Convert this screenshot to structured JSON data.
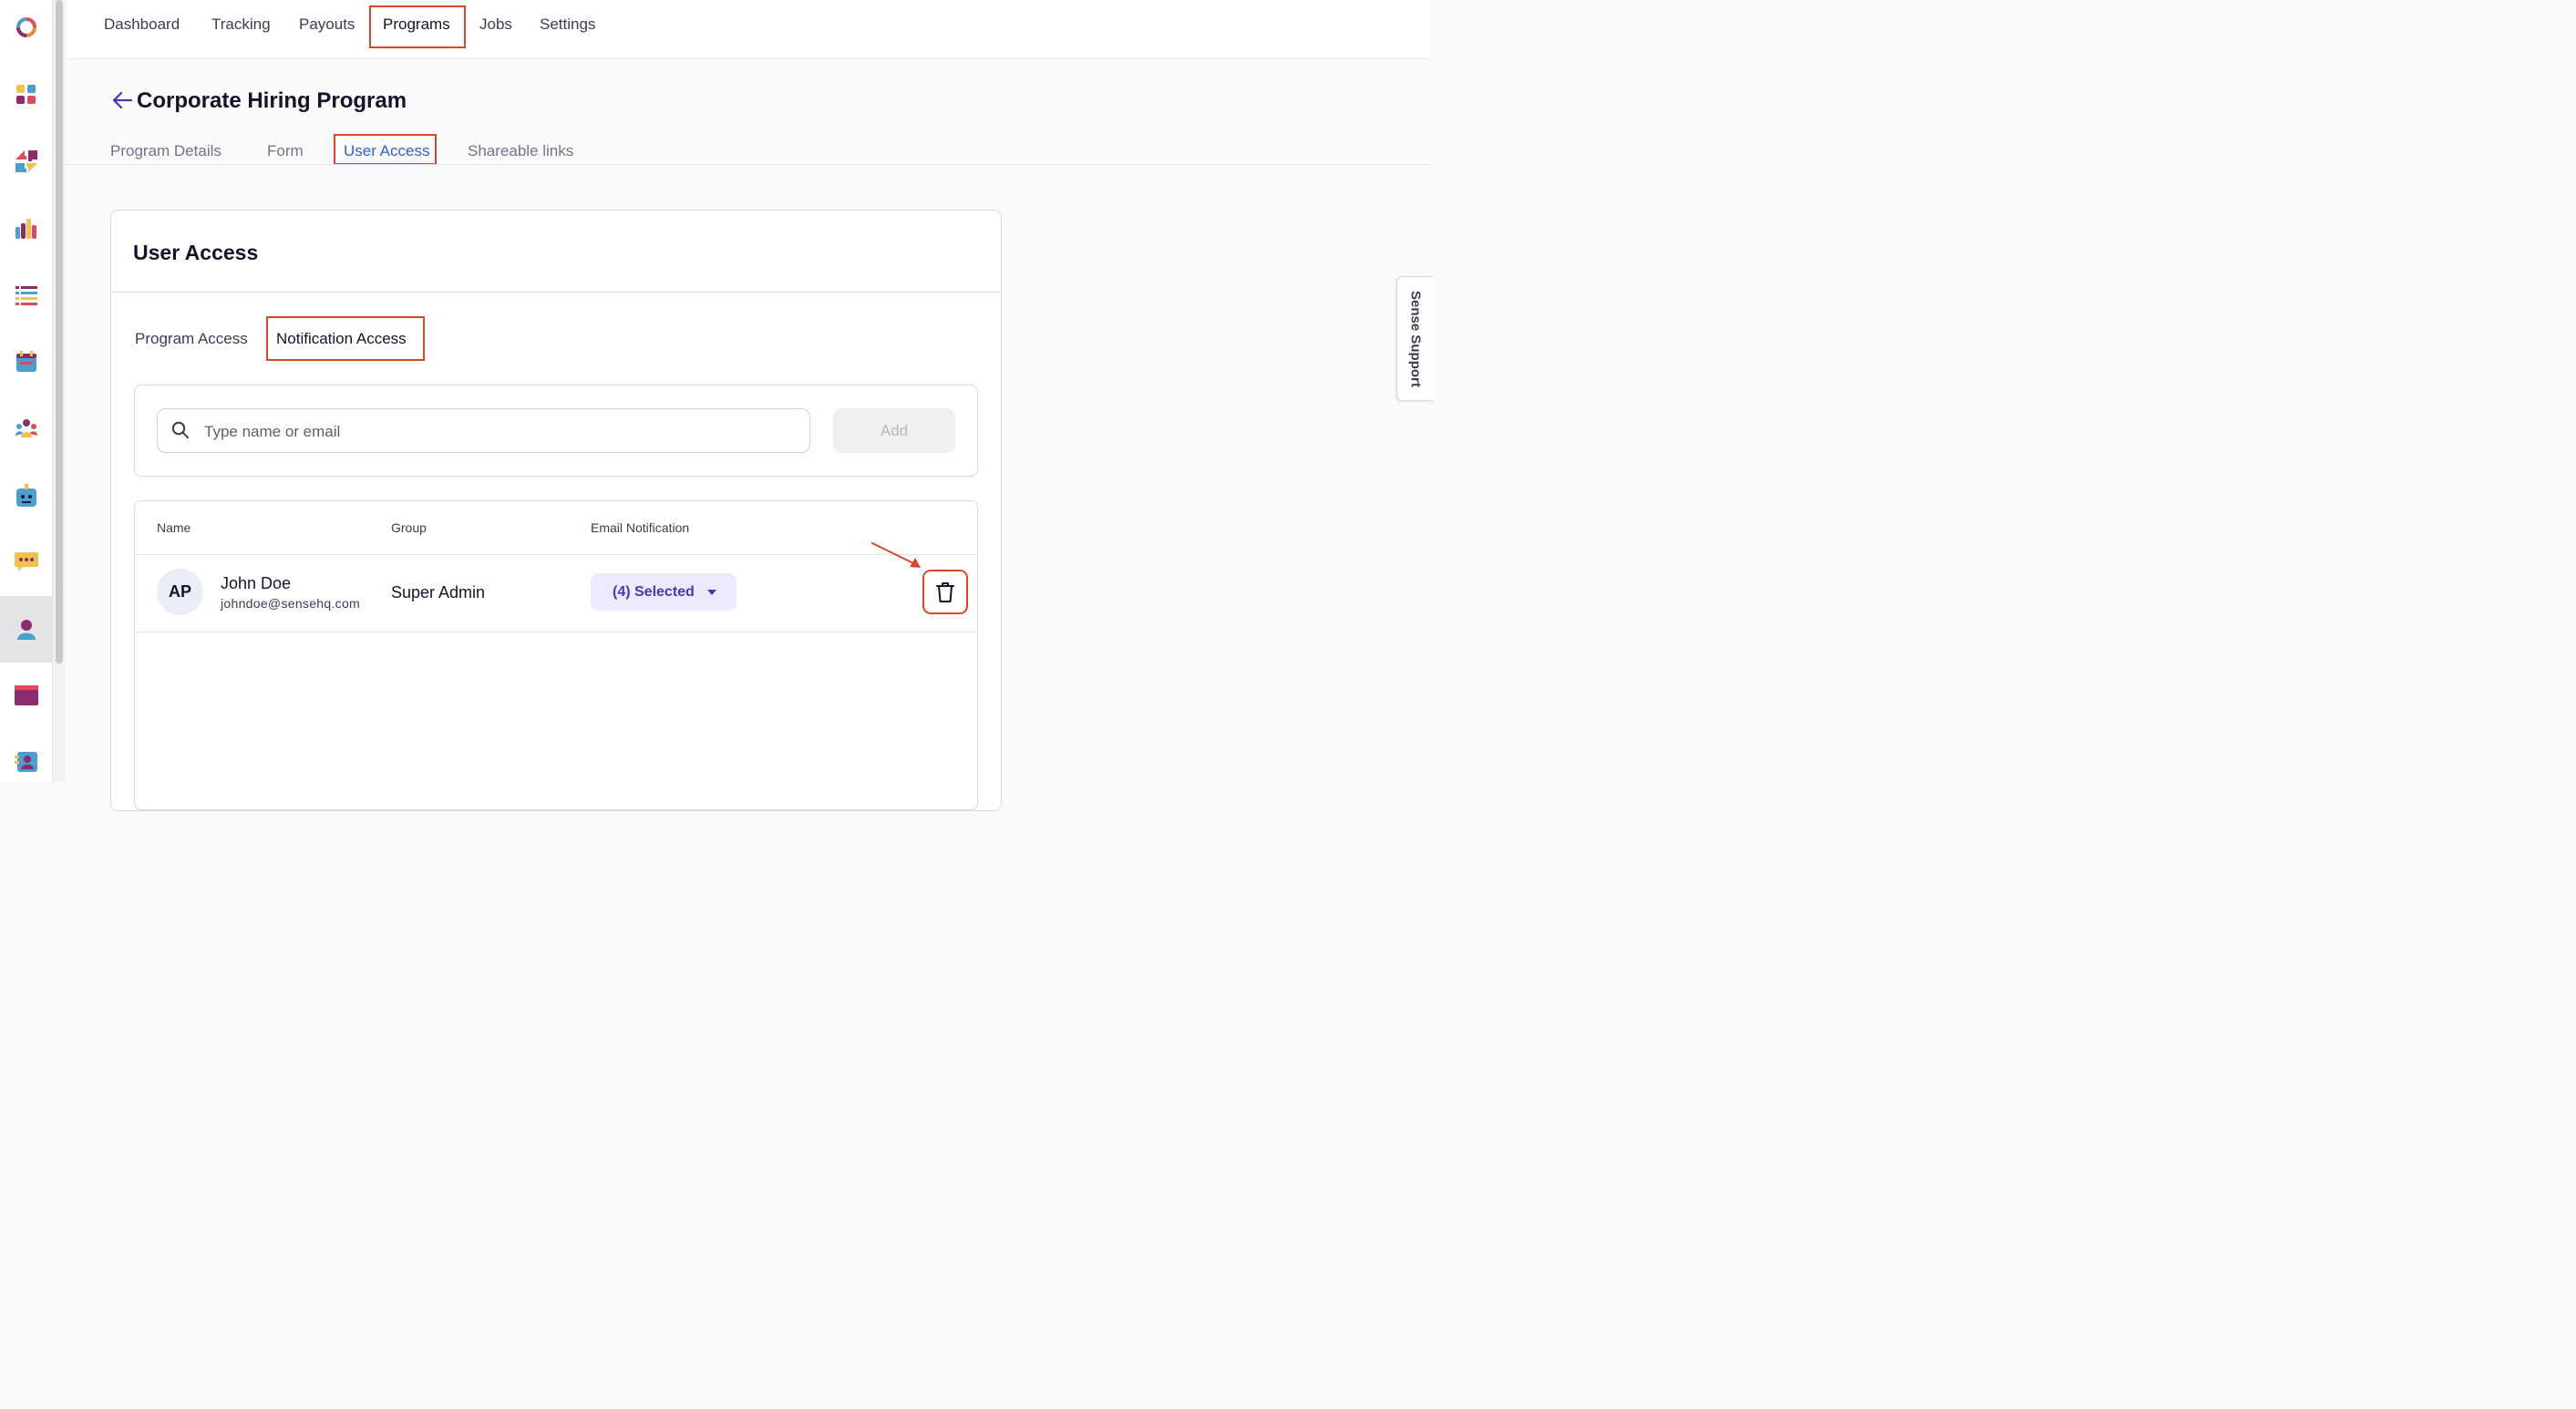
{
  "nav": {
    "items": [
      {
        "label": "Dashboard"
      },
      {
        "label": "Tracking"
      },
      {
        "label": "Payouts"
      },
      {
        "label": "Programs",
        "active": true
      },
      {
        "label": "Jobs"
      },
      {
        "label": "Settings"
      }
    ]
  },
  "rail": {
    "icons": [
      "logo-icon",
      "apps-icon",
      "transfer-icon",
      "analytics-icon",
      "list-icon",
      "calendar-icon",
      "team-icon",
      "bot-icon",
      "chat-icon",
      "user-icon",
      "window-icon",
      "contacts-icon"
    ],
    "active": "user-icon"
  },
  "page": {
    "title": "Corporate Hiring Program",
    "subtabs": [
      "Program Details",
      "Form",
      "User Access",
      "Shareable links"
    ],
    "active_subtab": "User Access"
  },
  "user_access": {
    "title": "User Access",
    "tabs": [
      "Program Access",
      "Notification Access"
    ],
    "active_tab": "Notification Access",
    "search": {
      "placeholder": "Type name or email",
      "value": ""
    },
    "add_label": "Add",
    "table": {
      "headers": {
        "name": "Name",
        "group": "Group",
        "email_notification": "Email Notification"
      },
      "rows": [
        {
          "initials": "AP",
          "name": "John Doe",
          "email": "johndoe@sensehq.com",
          "group": "Super Admin",
          "notification": "(4) Selected"
        }
      ]
    }
  },
  "support": {
    "label": "Sense Support"
  },
  "colors": {
    "accent": "#2f61d5",
    "annotation": "#e0442d",
    "dropdown_text": "#4c35b8"
  }
}
